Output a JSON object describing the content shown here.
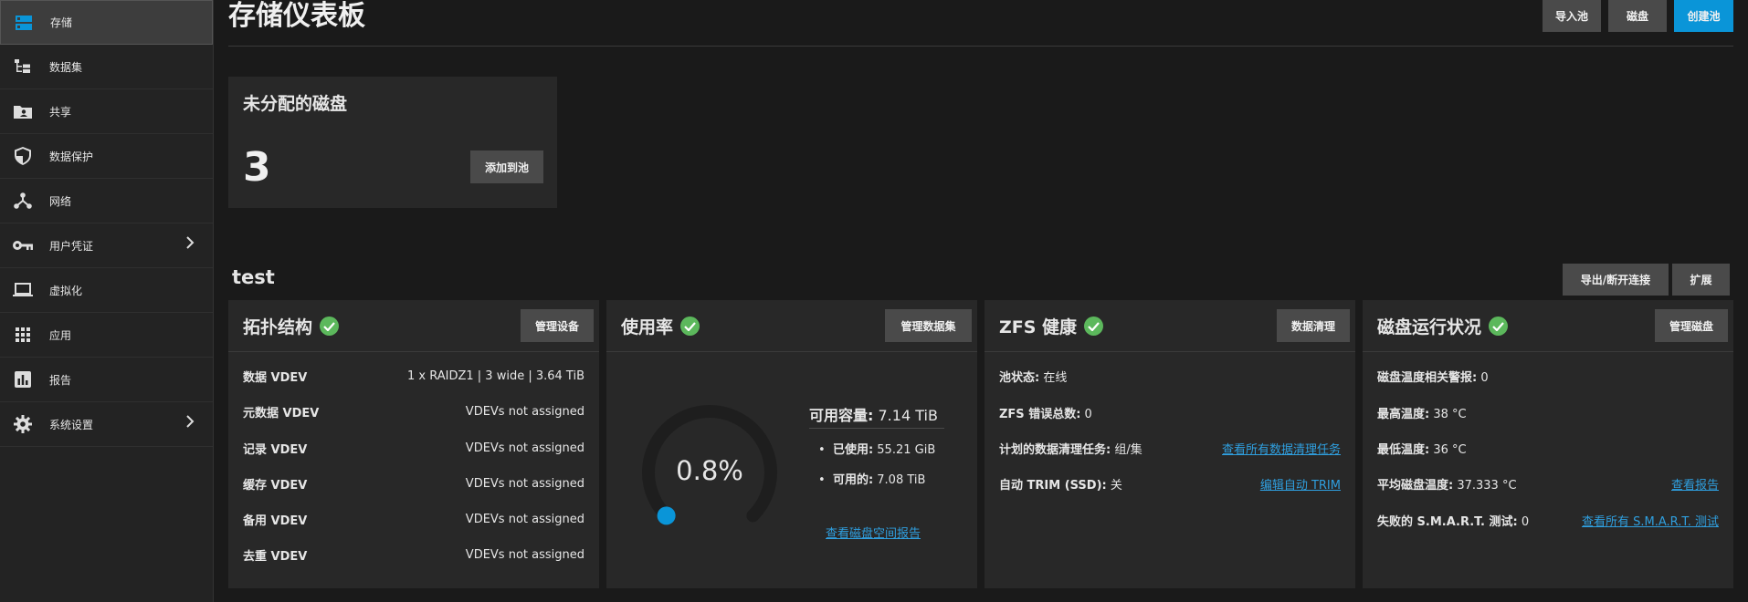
{
  "sidebar": {
    "items": [
      {
        "label": "存储",
        "icon": "storage-icon",
        "active": true
      },
      {
        "label": "数据集",
        "icon": "dataset-tree-icon"
      },
      {
        "label": "共享",
        "icon": "folder-share-icon"
      },
      {
        "label": "数据保护",
        "icon": "shield-icon"
      },
      {
        "label": "网络",
        "icon": "network-icon"
      },
      {
        "label": "用户凭证",
        "icon": "key-icon",
        "has_submenu": true
      },
      {
        "label": "虚拟化",
        "icon": "laptop-icon"
      },
      {
        "label": "应用",
        "icon": "apps-grid-icon"
      },
      {
        "label": "报告",
        "icon": "chart-icon"
      },
      {
        "label": "系统设置",
        "icon": "gear-icon",
        "has_submenu": true
      }
    ]
  },
  "header": {
    "title": "存储仪表板",
    "import_pool": "导入池",
    "disks": "磁盘",
    "create_pool": "创建池"
  },
  "unassigned": {
    "title": "未分配的磁盘",
    "count": "3",
    "add_to_pool": "添加到池"
  },
  "pool": {
    "name": "test",
    "export": "导出/断开连接",
    "expand": "扩展"
  },
  "topology": {
    "title": "拓扑结构",
    "button": "管理设备",
    "rows": [
      {
        "label": "数据 VDEV",
        "value": "1 x RAIDZ1 | 3 wide | 3.64 TiB"
      },
      {
        "label": "元数据 VDEV",
        "value": "VDEVs not assigned"
      },
      {
        "label": "记录 VDEV",
        "value": "VDEVs not assigned"
      },
      {
        "label": "缓存 VDEV",
        "value": "VDEVs not assigned"
      },
      {
        "label": "备用 VDEV",
        "value": "VDEVs not assigned"
      },
      {
        "label": "去重 VDEV",
        "value": "VDEVs not assigned"
      }
    ]
  },
  "usage": {
    "title": "使用率",
    "button": "管理数据集",
    "percent": "0.8%",
    "percent_value": 0.008,
    "capacity_label": "可用容量:",
    "capacity_value": "7.14 TiB",
    "used_label": "已使用:",
    "used_value": "55.21 GiB",
    "avail_label": "可用的:",
    "avail_value": "7.08 TiB",
    "report_link": "查看磁盘空间报告"
  },
  "zfs": {
    "title": "ZFS 健康",
    "button": "数据清理",
    "status_label": "池状态:",
    "status_value": "在线",
    "errors_label": "ZFS 错误总数:",
    "errors_value": "0",
    "scrub_label": "计划的数据清理任务:",
    "scrub_value": "组/集",
    "scrub_link": "查看所有数据清理任务",
    "trim_label": "自动 TRIM (SSD):",
    "trim_value": "关",
    "trim_link": "编辑自动 TRIM"
  },
  "disk_health": {
    "title": "磁盘运行状况",
    "button": "管理磁盘",
    "temp_alerts_label": "磁盘温度相关警报:",
    "temp_alerts_value": "0",
    "max_temp_label": "最高温度:",
    "max_temp_value": "38 °C",
    "min_temp_label": "最低温度:",
    "min_temp_value": "36 °C",
    "avg_temp_label": "平均磁盘温度:",
    "avg_temp_value": "37.333 °C",
    "avg_link": "查看报告",
    "smart_label": "失败的 S.M.A.R.T. 测试:",
    "smart_value": "0",
    "smart_link": "查看所有 S.M.A.R.T. 测试"
  },
  "colors": {
    "accent": "#0a95d8",
    "ok": "#5cb85c",
    "link": "#2f9fdf"
  }
}
